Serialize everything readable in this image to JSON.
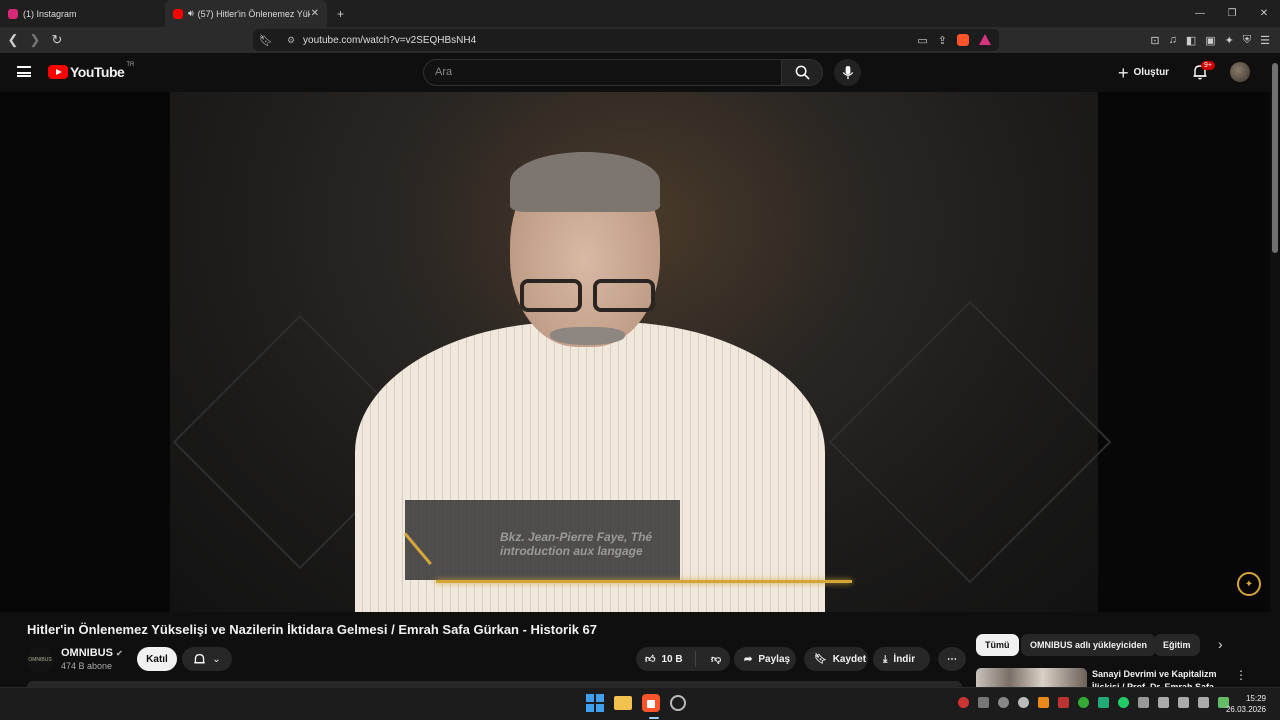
{
  "browser": {
    "tabs": [
      {
        "label": "(1) Instagram",
        "favicon_color": "#d62976"
      },
      {
        "label": "(57) Hitler'in Önlenemez Yük",
        "favicon_color": "#ff0000"
      }
    ],
    "url": "youtube.com/watch?v=v2SEQHBsNH4"
  },
  "youtube": {
    "logo_text": "YouTube",
    "region": "TR",
    "search_placeholder": "Ara",
    "create_label": "Oluştur",
    "notif_badge": "9+"
  },
  "video": {
    "caption_text_line1": "Bkz. Jean-Pierre Faye, Thé",
    "caption_text_line2": "introduction aux langage",
    "title": "Hitler'in Önlenemez Yükselişi ve Nazilerin İktidara Gelmesi / Emrah Safa Gürkan - Historik 67"
  },
  "channel": {
    "avatar_text": "OMNIBUS",
    "name": "OMNIBUS",
    "subscribers": "474 B abone",
    "join_label": "Katıl"
  },
  "actions": {
    "likes": "10 B",
    "share": "Paylaş",
    "save": "Kaydet",
    "download": "İndir"
  },
  "chips": [
    {
      "label": "Tümü",
      "active": true
    },
    {
      "label": "OMNIBUS adlı yükleyiciden",
      "active": false
    },
    {
      "label": "Eğitim",
      "active": false
    }
  ],
  "recommendation": {
    "title": "Sanayi Devrimi ve Kapitalizm İlişkisi / Prof. Dr. Emrah Safa"
  },
  "taskbar": {
    "time": "15:29",
    "date": "26.03.2026"
  },
  "colors": {
    "accent_gold": "#d4a63a",
    "youtube_red": "#ff0000",
    "background": "#0f0f0f"
  }
}
